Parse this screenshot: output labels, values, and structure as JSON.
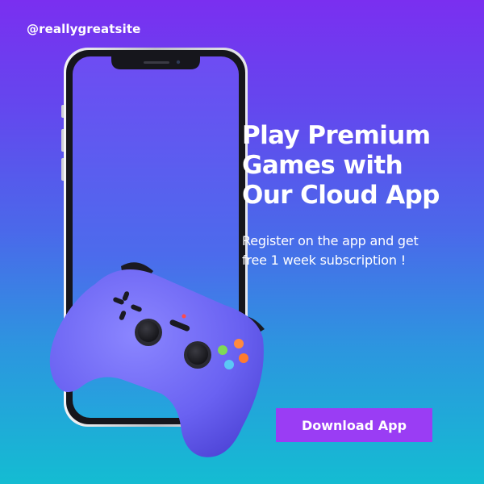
{
  "brand": {
    "handle": "@reallygreatsite"
  },
  "hero": {
    "headline_lines": [
      "Play Premium",
      "Games with",
      "Our Cloud App"
    ],
    "subtext_lines": [
      "Register on the app and get",
      "free 1 week subscription !"
    ]
  },
  "cta": {
    "label": "Download App"
  },
  "colors": {
    "background_top": "#7a2ff0",
    "background_bottom": "#14bcd2",
    "button": "#9a3df4",
    "controller_body": "#6a62f2",
    "text": "#ffffff"
  },
  "icons": {
    "phone": "smartphone-mockup",
    "controller": "game-controller"
  }
}
